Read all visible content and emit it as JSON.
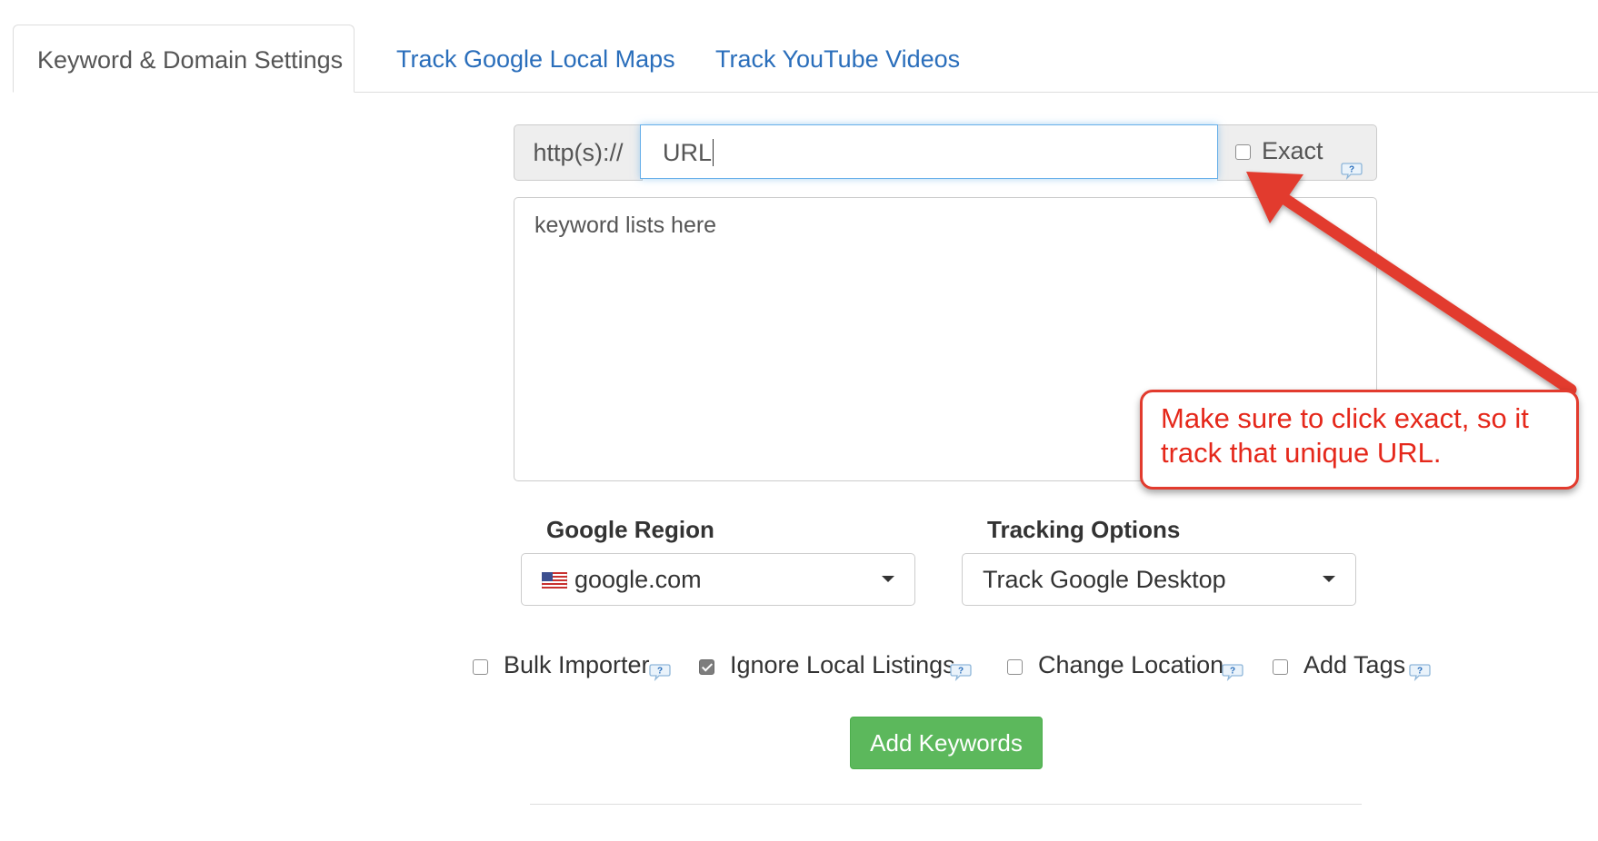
{
  "tabs": [
    {
      "label": "Keyword & Domain Settings",
      "active": true
    },
    {
      "label": "Track Google Local Maps",
      "active": false
    },
    {
      "label": "Track YouTube Videos",
      "active": false
    }
  ],
  "url_group": {
    "prefix": "http(s)://",
    "input_value": "URL",
    "exact_label": "Exact",
    "exact_checked": false
  },
  "keywords": {
    "placeholder": "keyword lists here"
  },
  "google_region": {
    "label": "Google Region",
    "selected": "google.com",
    "flag": "us-flag-icon"
  },
  "tracking_options": {
    "label": "Tracking Options",
    "selected": "Track Google Desktop"
  },
  "options": [
    {
      "label": "Bulk Importer",
      "checked": false
    },
    {
      "label": "Ignore Local Listings",
      "checked": true
    },
    {
      "label": "Change Location",
      "checked": false
    },
    {
      "label": "Add Tags",
      "checked": false
    }
  ],
  "actions": {
    "add_keywords": "Add Keywords"
  },
  "annotation": {
    "text": "Make sure to click exact, so it track that unique URL.",
    "color": "#e5281b"
  },
  "colors": {
    "link": "#2a6ebb",
    "success": "#5cb85c",
    "focus": "#66afe9"
  }
}
